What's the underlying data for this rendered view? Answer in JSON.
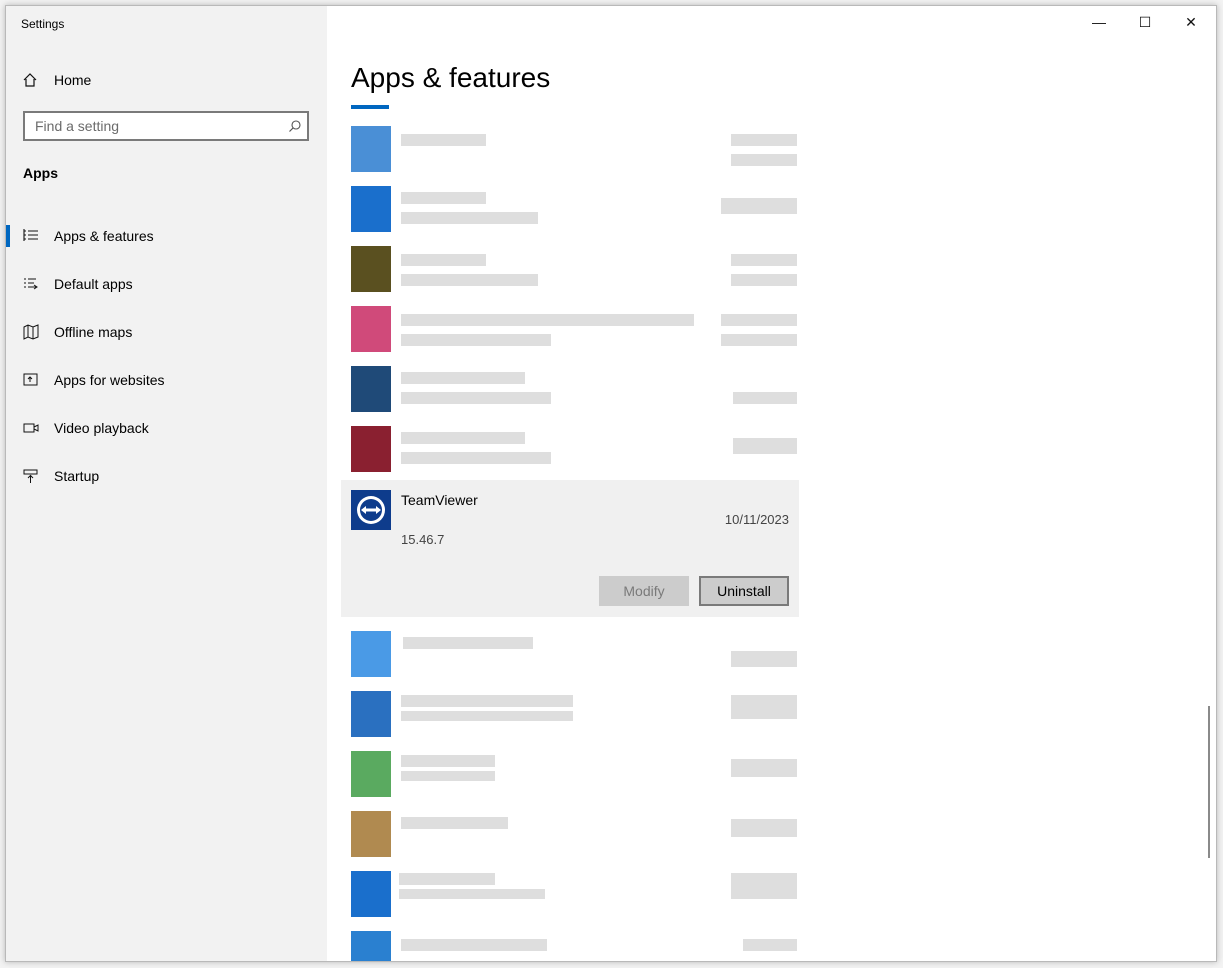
{
  "window": {
    "title": "Settings",
    "minimize_label": "—",
    "maximize_label": "☐",
    "close_label": "✕"
  },
  "sidebar": {
    "home_label": "Home",
    "search_placeholder": "Find a setting",
    "section_label": "Apps",
    "items": [
      {
        "label": "Apps & features",
        "icon": "apps-features-icon",
        "active": true
      },
      {
        "label": "Default apps",
        "icon": "default-apps-icon",
        "active": false
      },
      {
        "label": "Offline maps",
        "icon": "offline-maps-icon",
        "active": false
      },
      {
        "label": "Apps for websites",
        "icon": "apps-for-websites-icon",
        "active": false
      },
      {
        "label": "Video playback",
        "icon": "video-playback-icon",
        "active": false
      },
      {
        "label": "Startup",
        "icon": "startup-icon",
        "active": false
      }
    ]
  },
  "main": {
    "heading": "Apps & features",
    "selected_app": {
      "name": "TeamViewer",
      "date": "10/11/2023",
      "version": "15.46.7",
      "modify_label": "Modify",
      "uninstall_label": "Uninstall"
    }
  },
  "colors": {
    "accent": "#0067c0",
    "sidebar_bg": "#f2f2f2",
    "selected_bg": "#f0f0f0"
  }
}
